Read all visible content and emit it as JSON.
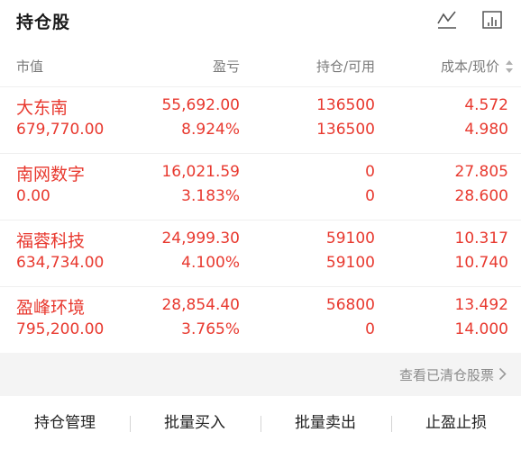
{
  "header": {
    "title": "持仓股",
    "trend_icon": "trend-line-icon",
    "chart_icon": "bar-chart-icon"
  },
  "columns": {
    "market_value": "市值",
    "pnl": "盈亏",
    "holding": "持仓/可用",
    "cost_price": "成本/现价"
  },
  "positions": [
    {
      "name": "大东南",
      "market_value": "679,770.00",
      "pnl": "55,692.00",
      "pnl_pct": "8.924%",
      "holding": "136500",
      "available": "136500",
      "cost": "4.572",
      "price": "4.980"
    },
    {
      "name": "南网数字",
      "market_value": "0.00",
      "pnl": "16,021.59",
      "pnl_pct": "3.183%",
      "holding": "0",
      "available": "0",
      "cost": "27.805",
      "price": "28.600"
    },
    {
      "name": "福蓉科技",
      "market_value": "634,734.00",
      "pnl": "24,999.30",
      "pnl_pct": "4.100%",
      "holding": "59100",
      "available": "59100",
      "cost": "10.317",
      "price": "10.740"
    },
    {
      "name": "盈峰环境",
      "market_value": "795,200.00",
      "pnl": "28,854.40",
      "pnl_pct": "3.765%",
      "holding": "56800",
      "available": "0",
      "cost": "13.492",
      "price": "14.000"
    }
  ],
  "cleared_link": "查看已清仓股票",
  "actions": {
    "manage": "持仓管理",
    "batch_buy": "批量买入",
    "batch_sell": "批量卖出",
    "stop": "止盈止损"
  },
  "colors": {
    "gain": "#e8392f",
    "text": "#1a1a1a",
    "muted": "#7a7a7a"
  }
}
